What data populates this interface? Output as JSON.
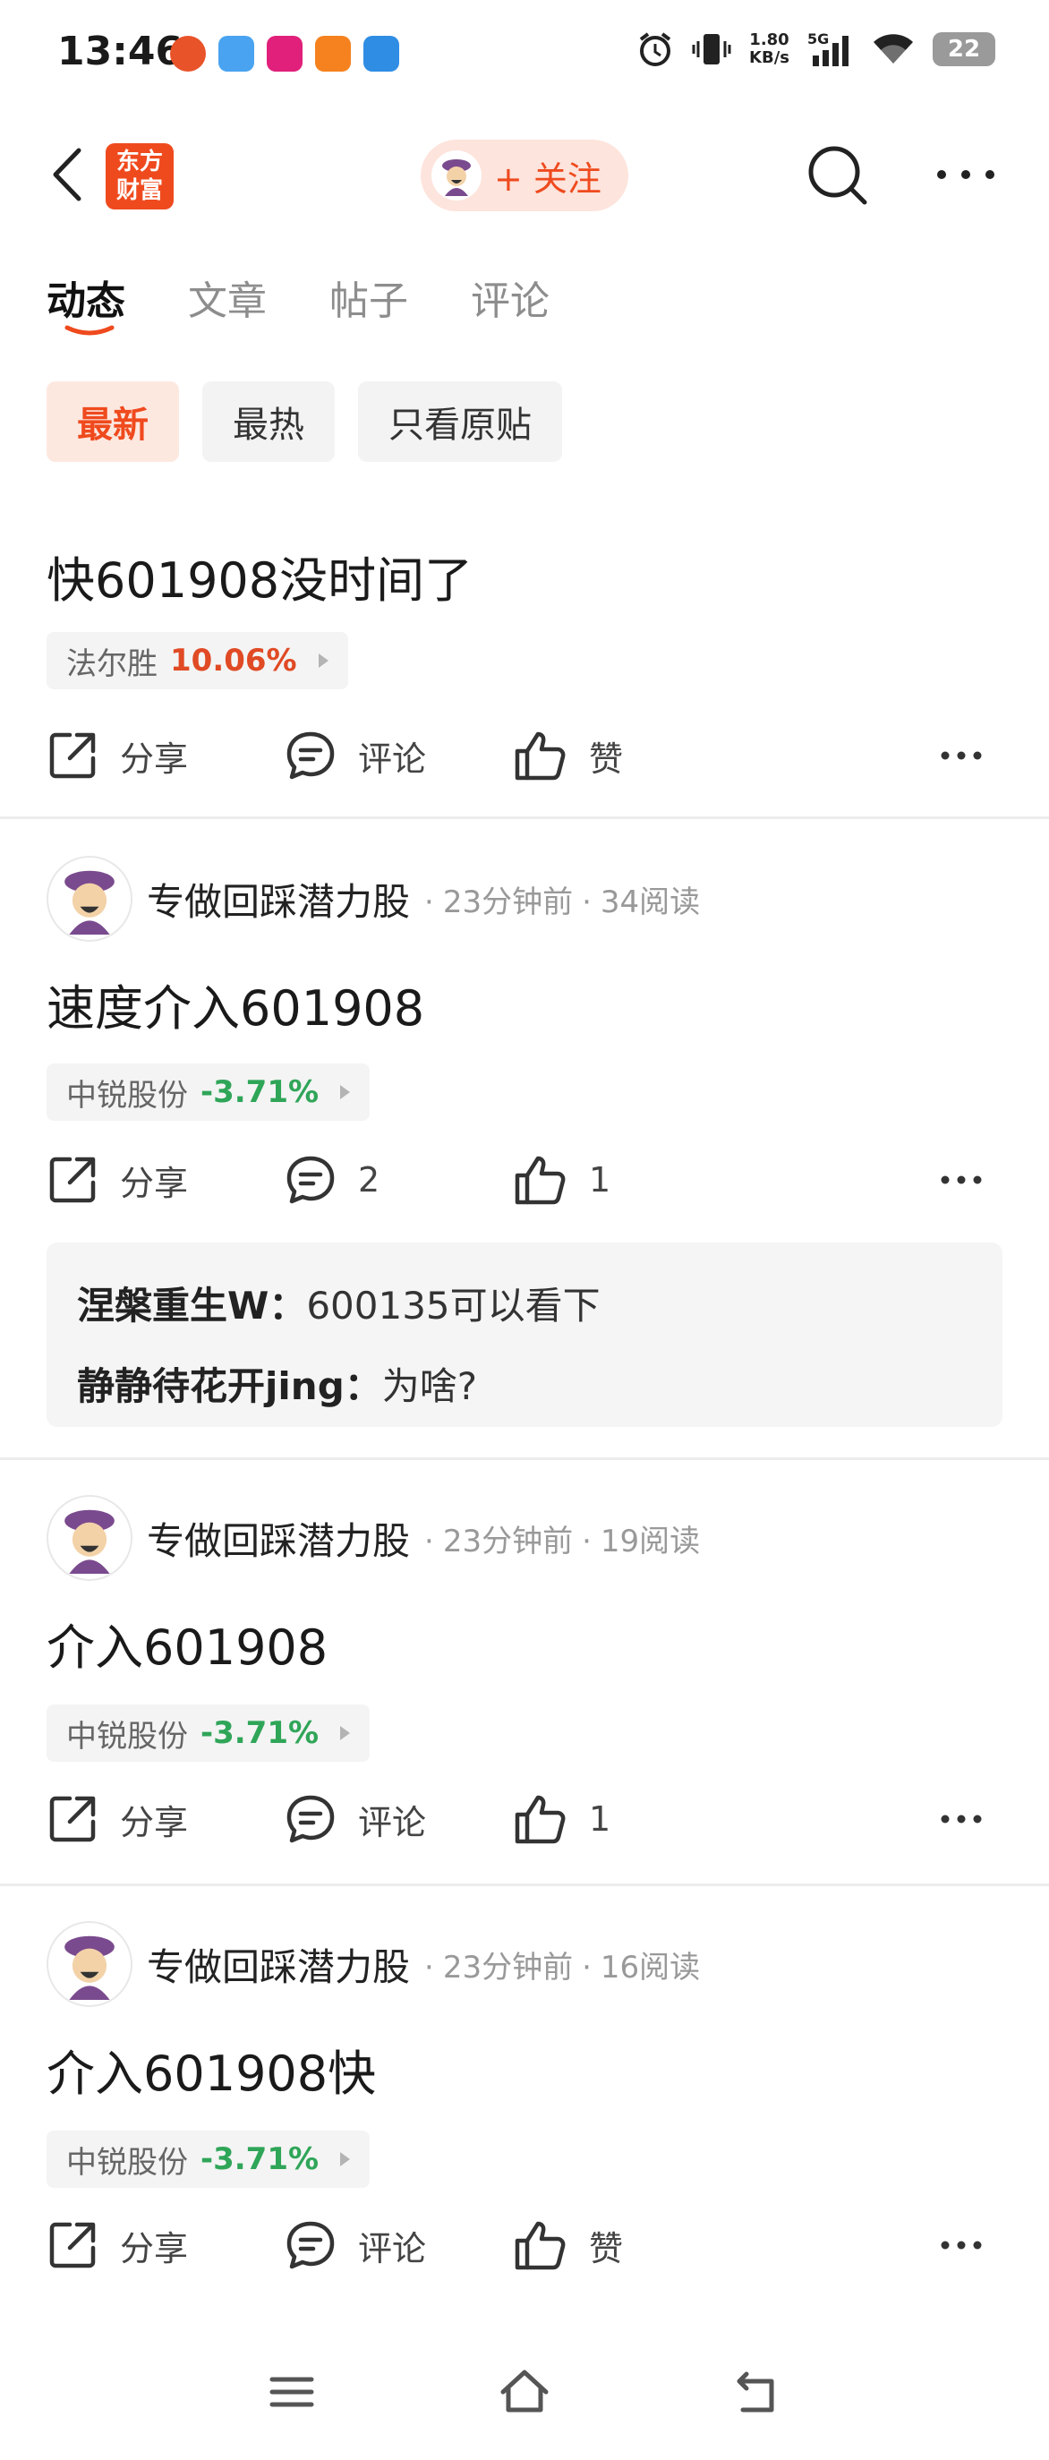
{
  "status_bar": {
    "time": "13:46",
    "net_speed_value": "1.80",
    "net_speed_unit": "KB/s",
    "network": "5G",
    "battery": "22"
  },
  "header": {
    "logo_line1": "东方",
    "logo_line2": "财富",
    "follow_label": "+ 关注"
  },
  "tabs": [
    {
      "label": "动态",
      "active": true
    },
    {
      "label": "文章",
      "active": false
    },
    {
      "label": "帖子",
      "active": false
    },
    {
      "label": "评论",
      "active": false
    }
  ],
  "filters": [
    {
      "label": "最新",
      "active": true
    },
    {
      "label": "最热",
      "active": false
    },
    {
      "label": "只看原贴",
      "active": false
    }
  ],
  "posts": [
    {
      "text": "快601908没时间了",
      "stock_name": "法尔胜",
      "stock_change": "10.06%",
      "share_label": "分享",
      "comment_label": "评论",
      "like_label": "赞"
    },
    {
      "author": "专做回踩潜力股",
      "time": "23分钟前",
      "reads": "34阅读",
      "text": "速度介入601908",
      "stock_name": "中锐股份",
      "stock_change": "-3.71%",
      "share_label": "分享",
      "comment_label": "2",
      "like_label": "1",
      "replies": [
        {
          "user": "涅槃重生W：",
          "text": "600135可以看下"
        },
        {
          "user": "静静待花开jing：",
          "text": "为啥?"
        }
      ]
    },
    {
      "author": "专做回踩潜力股",
      "time": "23分钟前",
      "reads": "19阅读",
      "text": "介入601908",
      "stock_name": "中锐股份",
      "stock_change": "-3.71%",
      "share_label": "分享",
      "comment_label": "评论",
      "like_label": "1"
    },
    {
      "author": "专做回踩潜力股",
      "time": "23分钟前",
      "reads": "16阅读",
      "text": "介入601908快",
      "stock_name": "中锐股份",
      "stock_change": "-3.71%",
      "share_label": "分享",
      "comment_label": "评论",
      "like_label": "赞"
    }
  ],
  "colors": {
    "accent": "#ef4a1e",
    "up": "#e04a24",
    "down": "#2fa558"
  }
}
